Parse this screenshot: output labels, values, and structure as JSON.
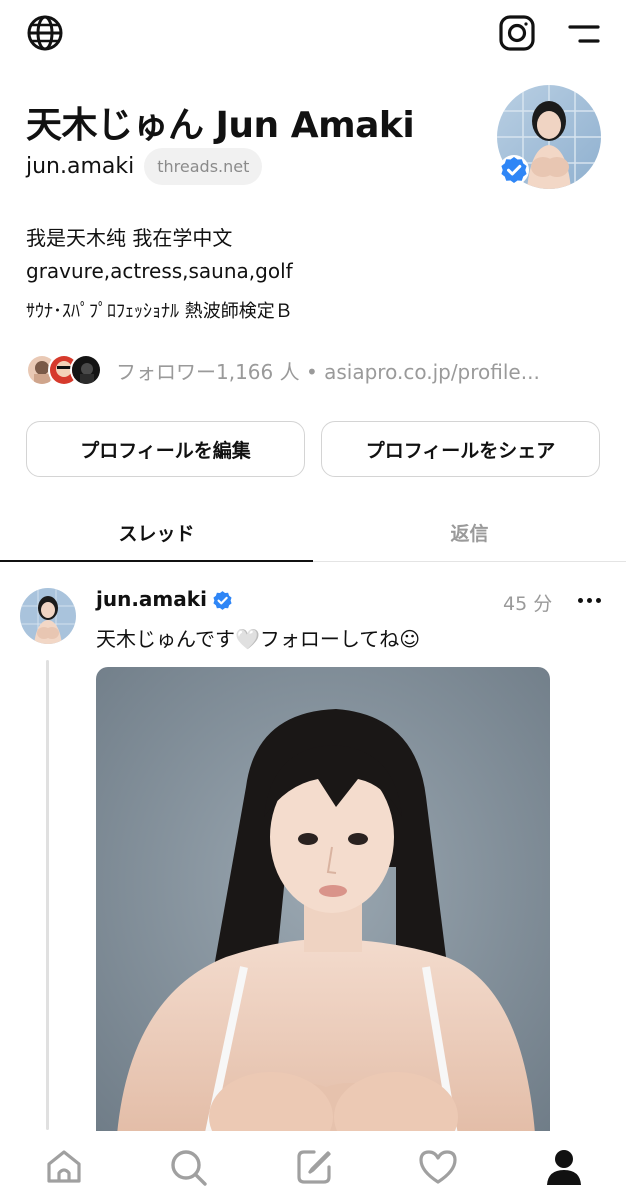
{
  "profile": {
    "name": "天木じゅん Jun Amaki",
    "handle": "jun.amaki",
    "domain_chip": "threads.net",
    "bio": [
      "我是天木纯 我在学中文",
      "gravure,actress,sauna,golf",
      "ｻｳﾅ･ｽﾊﾟﾌﾟﾛﾌｪｯｼｮﾅﾙ 熱波師検定Ｂ"
    ],
    "followers_text": "フォロワー1,166 人 • asiapro.co.jp/profile...",
    "verified": true
  },
  "buttons": {
    "edit_label": "プロフィールを編集",
    "share_label": "プロフィールをシェア"
  },
  "tabs": {
    "threads_label": "スレッド",
    "replies_label": "返信",
    "active": "threads"
  },
  "post": {
    "handle": "jun.amaki",
    "time": "45 分",
    "text": "天木じゅんです🤍フォローしてね☺"
  },
  "icons": {
    "top_left": "globe-icon",
    "top_right_1": "instagram-icon",
    "top_right_2": "menu-icon",
    "nav": [
      "home-icon",
      "search-icon",
      "compose-icon",
      "heart-icon",
      "profile-icon"
    ]
  },
  "colors": {
    "verified": "#2f86f6",
    "muted_text": "#9a9a9a",
    "chip_bg": "#f1f1f1"
  }
}
